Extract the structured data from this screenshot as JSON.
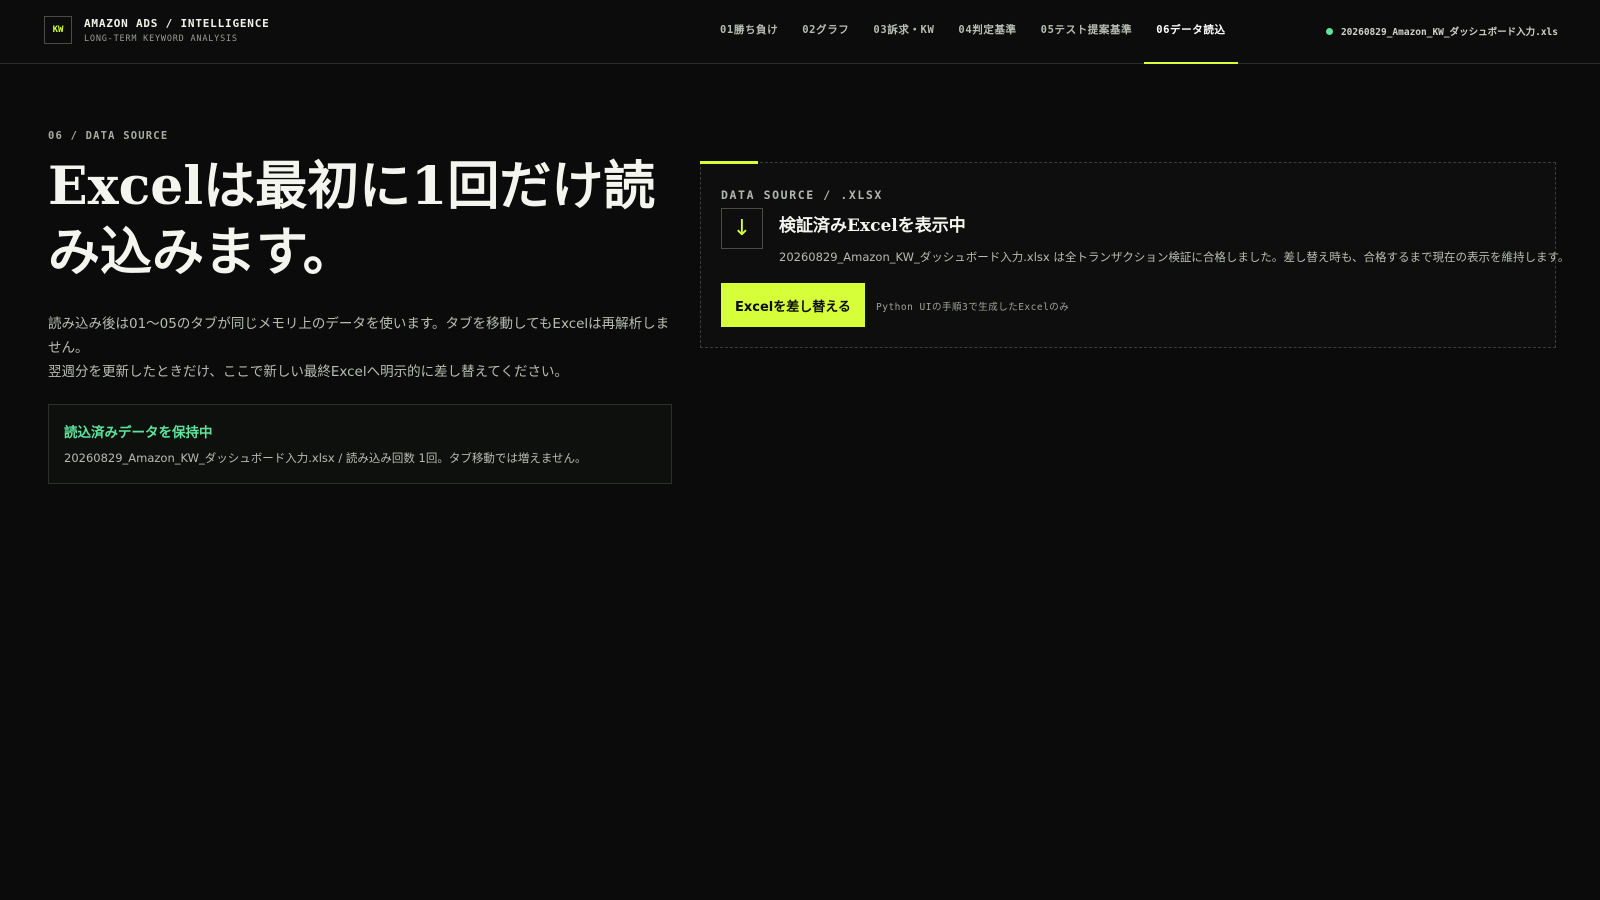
{
  "header": {
    "logo_text": "KW",
    "title": "AMAZON ADS / INTELLIGENCE",
    "subtitle": "LONG-TERM KEYWORD ANALYSIS",
    "tabs": [
      {
        "label": "01勝ち負け"
      },
      {
        "label": "02グラフ"
      },
      {
        "label": "03訴求・KW"
      },
      {
        "label": "04判定基準"
      },
      {
        "label": "05テスト提案基準"
      },
      {
        "label": "06データ読込"
      }
    ],
    "active_tab": "06データ読込",
    "file_status": "20260829_Amazon_KW_ダッシュボード入力.xls"
  },
  "left": {
    "eyebrow": "06 / DATA SOURCE",
    "headline": "Excelは最初に1回だけ読み込みます。",
    "lede_line1": "読み込み後は01〜05のタブが同じメモリ上のデータを使います。タブを移動してもExcelは再解析しません。",
    "lede_line2": "翌週分を更新したときだけ、ここで新しい最終Excelへ明示的に差し替えてください。",
    "status_card": {
      "title": "読込済みデータを保持中",
      "detail": "20260829_Amazon_KW_ダッシュボード入力.xlsx / 読み込み回数 1回。タブ移動では増えません。"
    }
  },
  "right": {
    "label": "DATA SOURCE / .XLSX",
    "icon": "download-arrow-icon",
    "title": "検証済みExcelを表示中",
    "detail": "20260829_Amazon_KW_ダッシュボード入力.xlsx は全トランザクション検証に合格しました。差し替え時も、合格するまで現在の表示を維持します。",
    "button_label": "Excelを差し替える",
    "button_note": "Python UIの手順3で生成したExcelのみ"
  },
  "colors": {
    "accent": "#d6ff3a",
    "success": "#5ce59a",
    "background": "#0a0b0a"
  }
}
